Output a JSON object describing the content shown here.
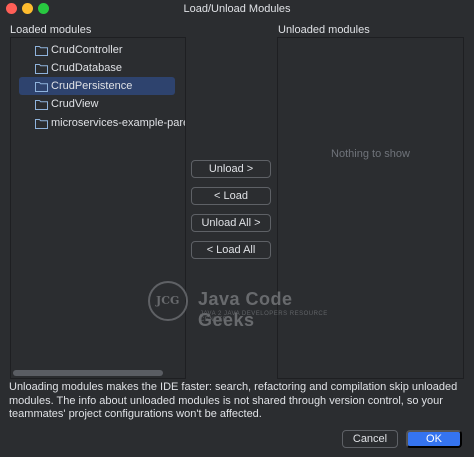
{
  "window": {
    "title": "Load/Unload Modules"
  },
  "loaded": {
    "label": "Loaded modules",
    "items": [
      {
        "label": "CrudController"
      },
      {
        "label": "CrudDatabase"
      },
      {
        "label": "CrudPersistence",
        "selected": true
      },
      {
        "label": "CrudView"
      },
      {
        "label": "microservices-example-parent"
      }
    ]
  },
  "unloaded": {
    "label": "Unloaded modules",
    "empty_text": "Nothing to show"
  },
  "actions": {
    "unload": "Unload >",
    "load": "< Load",
    "unload_all": "Unload All >",
    "load_all": "< Load All"
  },
  "watermark": {
    "logo_text": "JCG",
    "title": "Java Code Geeks",
    "subtitle": "JAVA 2 JAVA DEVELOPERS RESOURCE CENTER"
  },
  "info_text": "Unloading modules makes the IDE faster: search, refactoring and compilation skip unloaded modules. The info about unloaded modules is not shared through version control, so your teammates' project configurations won't be affected.",
  "footer": {
    "cancel": "Cancel",
    "ok": "OK"
  },
  "colors": {
    "background": "#2b2d30",
    "selection": "#2e436e",
    "primary_button": "#3574f0",
    "folder_icon": "#8fb3dc"
  }
}
